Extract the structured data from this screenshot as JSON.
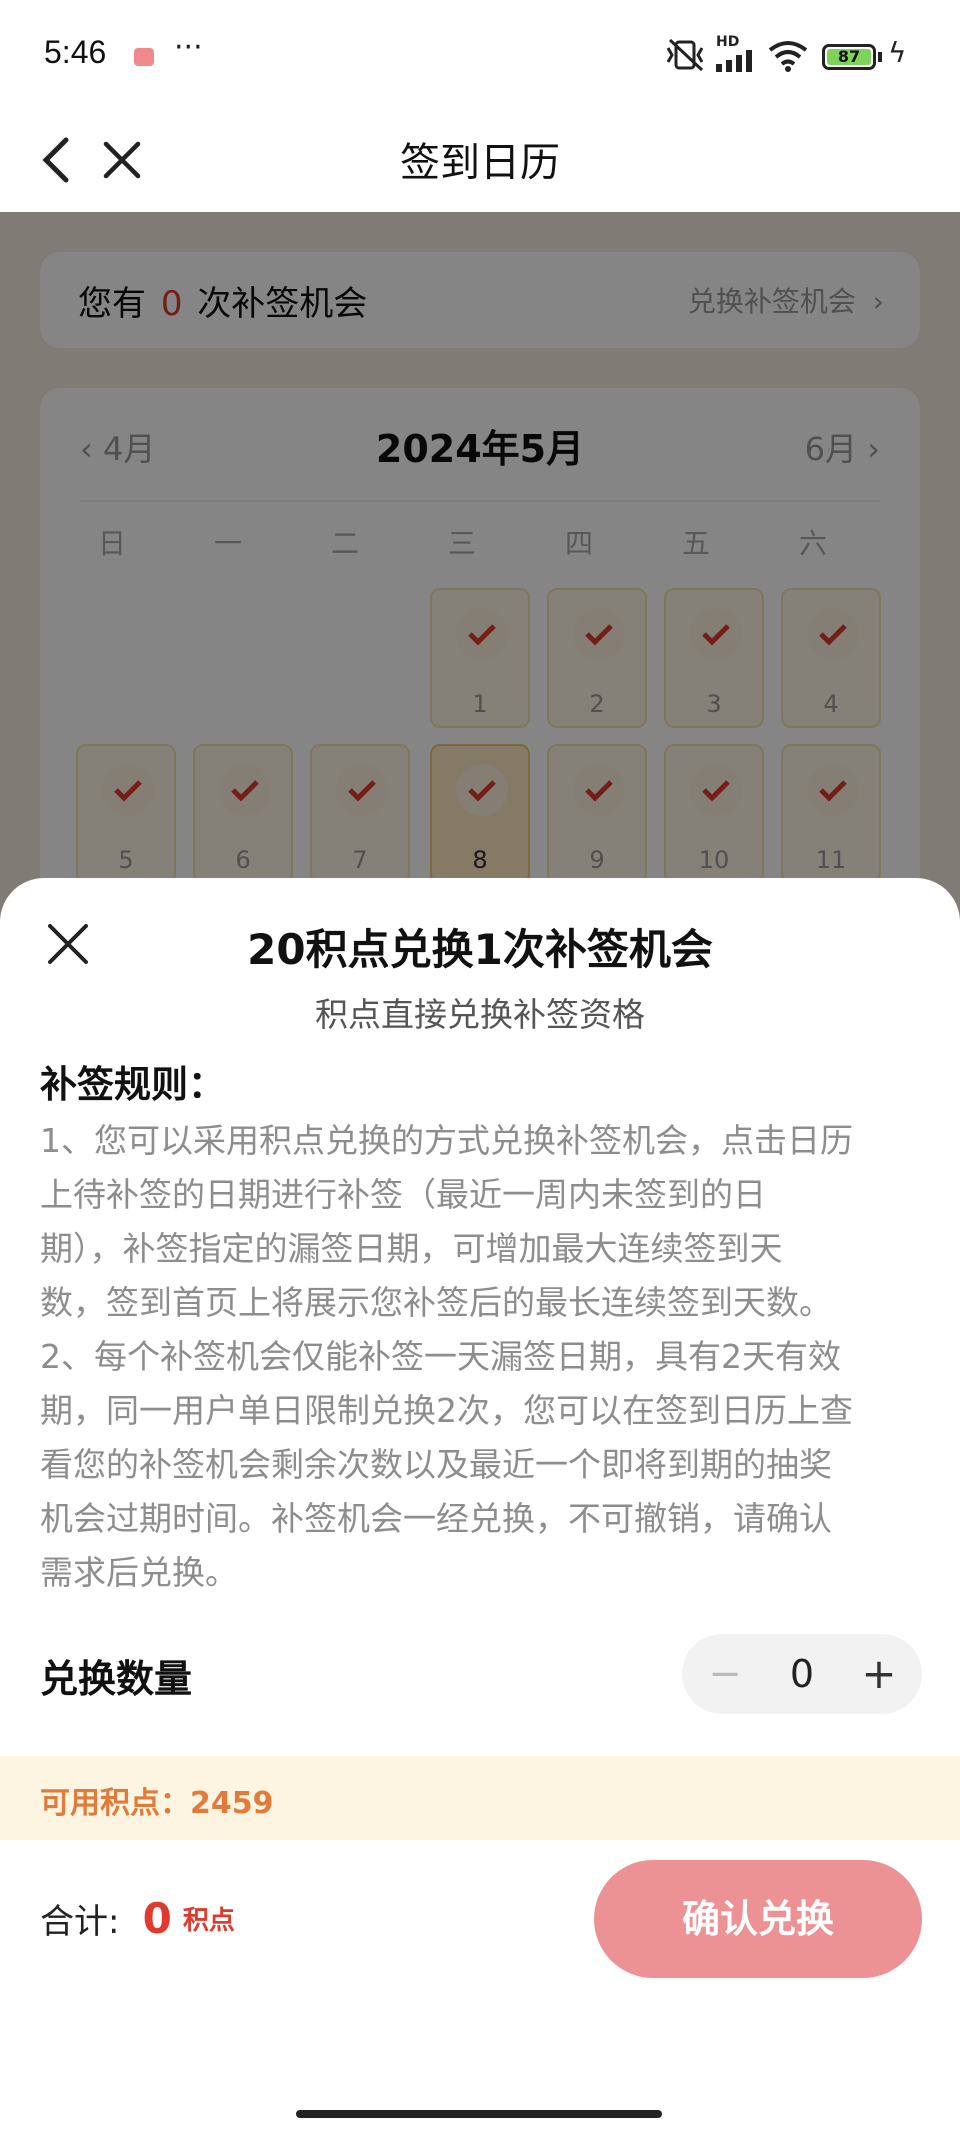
{
  "status_bar": {
    "time": "5:46",
    "battery": "87",
    "hd": "HD"
  },
  "nav": {
    "title": "签到日历"
  },
  "chance_bar": {
    "prefix": "您有",
    "count": "0",
    "suffix": "次补签机会",
    "exchange_link": "兑换补签机会"
  },
  "calendar": {
    "prev_month": "4月",
    "title": "2024年5月",
    "next_month": "6月",
    "weekdays": [
      "日",
      "一",
      "二",
      "三",
      "四",
      "五",
      "六"
    ],
    "days": [
      "1",
      "2",
      "3",
      "4",
      "5",
      "6",
      "7",
      "8",
      "9",
      "10",
      "11"
    ]
  },
  "sheet": {
    "title": "20积点兑换1次补签机会",
    "subtitle": "积点直接兑换补签资格",
    "rules_heading": "补签规则：",
    "rules_lines": [
      "1、您可以采用积点兑换的方式兑换补签机会，点击日历",
      "上待补签的日期进行补签（最近一周内未签到的日",
      "期），补签指定的漏签日期，可增加最大连续签到天",
      "数，签到首页上将展示您补签后的最长连续签到天数。",
      "2、每个补签机会仅能补签一天漏签日期，具有2天有效",
      "期，同一用户单日限制兑换2次，您可以在签到日历上查",
      "看您的补签机会剩余次数以及最近一个即将到期的抽奖",
      "机会过期时间。补签机会一经兑换，不可撤销，请确认",
      "需求后兑换。"
    ],
    "quantity_label": "兑换数量",
    "quantity_value": "0",
    "minus": "−",
    "plus": "+",
    "available_points": "可用积点：2459",
    "total_label": "合计:",
    "total_value": "0",
    "total_unit": "积点",
    "confirm_button": "确认兑换"
  },
  "colors": {
    "accent_red": "#e03a2f",
    "confirm_button_bg": "#ec9294",
    "points_banner_bg": "#fdf5e2",
    "points_text": "#e07b3a"
  }
}
